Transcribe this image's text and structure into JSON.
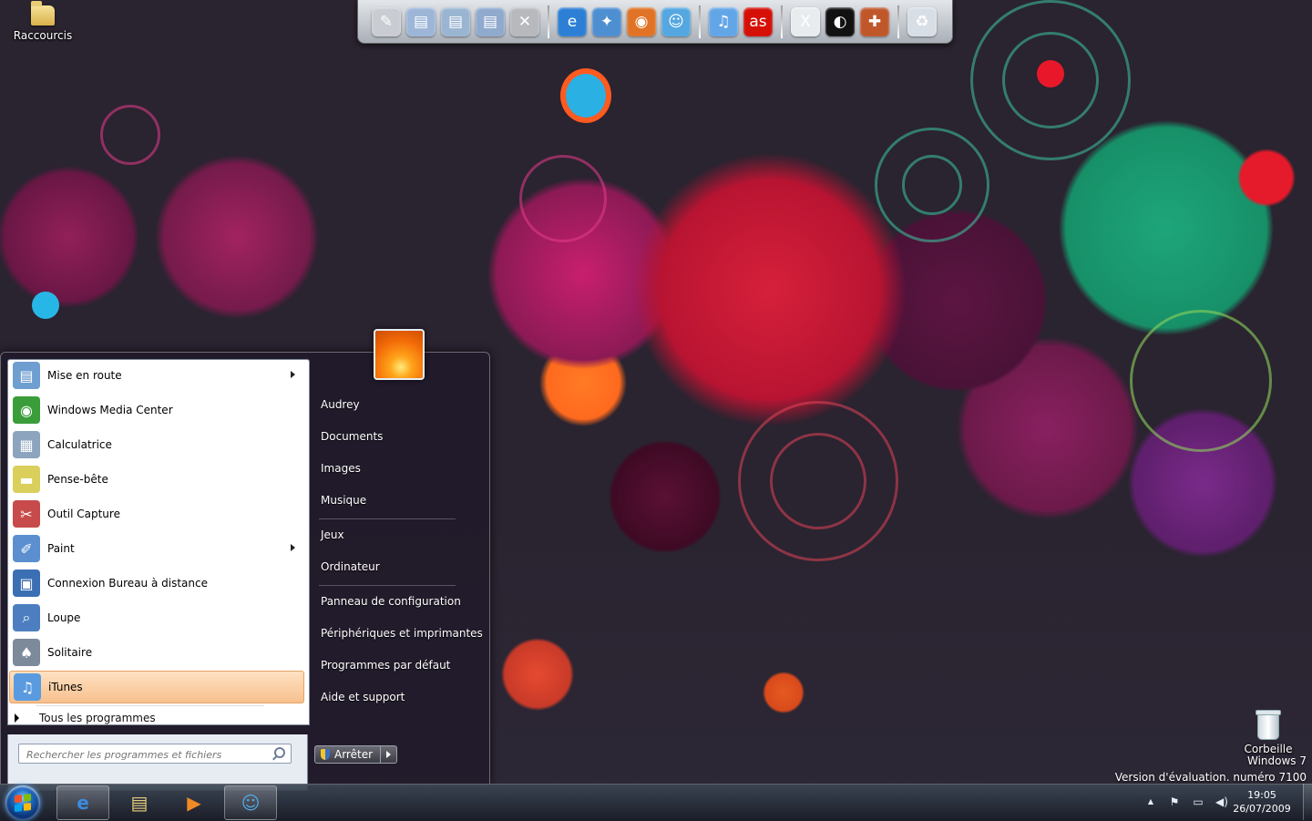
{
  "desktop": {
    "icons": [
      {
        "label": "Raccourcis",
        "icon": "folder-icon"
      },
      {
        "label": "Corbeille",
        "icon": "recycle-bin-icon"
      }
    ],
    "watermark": {
      "line1": "Windows 7",
      "line2": "Version d'évaluation. numéro 7100"
    }
  },
  "dock": {
    "items": [
      {
        "name": "notepad",
        "glyph": "✎",
        "color": "#c9ccd2"
      },
      {
        "name": "folder-documents",
        "glyph": "▤",
        "color": "#9db6d8"
      },
      {
        "name": "folder-downloads",
        "glyph": "▤",
        "color": "#9ab5d1"
      },
      {
        "name": "folder-pictures",
        "glyph": "▤",
        "color": "#90aace"
      },
      {
        "name": "tools",
        "glyph": "✕",
        "color": "#b7b9bd"
      },
      {
        "name": "internet-explorer",
        "glyph": "e",
        "color": "#2d7fd6"
      },
      {
        "name": "safari",
        "glyph": "✦",
        "color": "#4d8fd1"
      },
      {
        "name": "firefox",
        "glyph": "◉",
        "color": "#e07325"
      },
      {
        "name": "messenger",
        "glyph": "☺",
        "color": "#54a7e0"
      },
      {
        "name": "itunes",
        "glyph": "♫",
        "color": "#63a6e8"
      },
      {
        "name": "lastfm",
        "glyph": "as",
        "color": "#d51007"
      },
      {
        "name": "xfire",
        "glyph": "X",
        "color": "#e9ecef"
      },
      {
        "name": "steam",
        "glyph": "◐",
        "color": "#111111"
      },
      {
        "name": "team-fortress",
        "glyph": "✚",
        "color": "#c0572b"
      },
      {
        "name": "recycle-bin",
        "glyph": "♻",
        "color": "#d8dee5"
      }
    ]
  },
  "start_menu": {
    "programs": [
      {
        "label": "Mise en route",
        "icon": "getting-started-icon",
        "glyph": "▤",
        "color": "#6f9ed1",
        "submenu": true
      },
      {
        "label": "Windows Media Center",
        "icon": "media-center-icon",
        "glyph": "◉",
        "color": "#3a9d3a",
        "submenu": false
      },
      {
        "label": "Calculatrice",
        "icon": "calculator-icon",
        "glyph": "▦",
        "color": "#8ca4bd",
        "submenu": false
      },
      {
        "label": "Pense-bête",
        "icon": "sticky-notes-icon",
        "glyph": "▬",
        "color": "#d9cf5a",
        "submenu": false
      },
      {
        "label": "Outil Capture",
        "icon": "snipping-tool-icon",
        "glyph": "✂",
        "color": "#c84b4b",
        "submenu": false
      },
      {
        "label": "Paint",
        "icon": "paint-icon",
        "glyph": "✐",
        "color": "#5c8fcf",
        "submenu": true
      },
      {
        "label": "Connexion Bureau à distance",
        "icon": "remote-desktop-icon",
        "glyph": "▣",
        "color": "#3b6fb3",
        "submenu": false
      },
      {
        "label": "Loupe",
        "icon": "magnifier-icon",
        "glyph": "⌕",
        "color": "#4d7fc0",
        "submenu": false
      },
      {
        "label": "Solitaire",
        "icon": "solitaire-icon",
        "glyph": "♠",
        "color": "#7c8a9a",
        "submenu": false
      },
      {
        "label": "iTunes",
        "icon": "itunes-icon",
        "glyph": "♫",
        "color": "#5a9be0",
        "submenu": false,
        "selected": true
      }
    ],
    "all_programs": "Tous les programmes",
    "search_placeholder": "Rechercher les programmes et fichiers",
    "right_links": [
      {
        "label": "Audrey",
        "name": "user-folder-link"
      },
      {
        "label": "Documents",
        "name": "documents-link"
      },
      {
        "label": "Images",
        "name": "pictures-link"
      },
      {
        "label": "Musique",
        "name": "music-link"
      },
      {
        "label": "Jeux",
        "name": "games-link"
      },
      {
        "label": "Ordinateur",
        "name": "computer-link"
      },
      {
        "label": "Panneau de configuration",
        "name": "control-panel-link"
      },
      {
        "label": "Périphériques et imprimantes",
        "name": "devices-printers-link"
      },
      {
        "label": "Programmes par défaut",
        "name": "default-programs-link"
      },
      {
        "label": "Aide et support",
        "name": "help-support-link"
      }
    ],
    "shutdown_label": "Arrêter"
  },
  "taskbar": {
    "pinned": [
      {
        "name": "internet-explorer",
        "glyph": "e",
        "color": "#3a8ae0",
        "active": true
      },
      {
        "name": "windows-explorer",
        "glyph": "▤",
        "color": "#e9cf7c",
        "active": false
      },
      {
        "name": "media-player",
        "glyph": "▶",
        "color": "#f08a24",
        "active": false
      },
      {
        "name": "messenger",
        "glyph": "☺",
        "color": "#54a7e0",
        "active": true
      }
    ],
    "tray_icons": [
      "show-hidden-icons",
      "action-center-icon",
      "network-icon",
      "volume-icon"
    ],
    "clock": {
      "time": "19:05",
      "date": "26/07/2009"
    }
  }
}
